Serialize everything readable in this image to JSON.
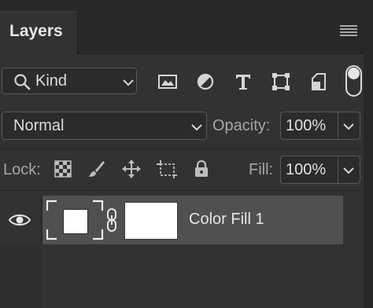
{
  "panel": {
    "title": "Layers",
    "menu_icon": "hamburger-menu-icon"
  },
  "filter": {
    "kind_label": "Kind",
    "search_icon": "search-icon",
    "icons": [
      "image-filter-icon",
      "adjustment-filter-icon",
      "type-filter-icon",
      "shape-filter-icon",
      "smart-object-filter-icon"
    ],
    "toggle_state": "on"
  },
  "blend": {
    "mode": "Normal",
    "opacity_label": "Opacity:",
    "opacity_value": "100%"
  },
  "lock": {
    "label": "Lock:",
    "icons": [
      "lock-transparent-pixels-icon",
      "lock-image-pixels-icon",
      "lock-position-icon",
      "lock-artboard-icon",
      "lock-all-icon"
    ],
    "fill_label": "Fill:",
    "fill_value": "100%"
  },
  "layers": [
    {
      "name": "Color Fill 1",
      "visible": true,
      "fill_color": "#ffffff",
      "mask_color": "#ffffff",
      "selected": true
    }
  ],
  "colors": {
    "panel_bg": "#323232",
    "selected_row": "#505050",
    "text": "#d6d6d6"
  }
}
